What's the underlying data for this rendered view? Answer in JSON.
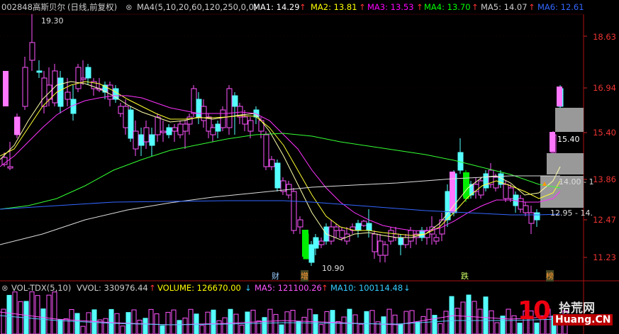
{
  "header": {
    "code": "002848",
    "name": "高斯贝尔",
    "mode": "(日线,前复权)",
    "indicator": "MA4(5,10,20,60,120,250,0,0)",
    "ma": [
      {
        "label": "MA1: 14.29",
        "color": "#ffffff",
        "arrow": "↑"
      },
      {
        "label": "MA2: 13.81",
        "color": "#ffff00",
        "arrow": "↑"
      },
      {
        "label": "MA3: 13.53",
        "color": "#ff00ff",
        "arrow": "↑"
      },
      {
        "label": "MA4: 13.70",
        "color": "#00ff00",
        "arrow": "↑"
      },
      {
        "label": "MA5: 14.07",
        "color": "#cccccc",
        "arrow": "↑"
      },
      {
        "label": "MA6: 12.61",
        "color": "#3366ff",
        "arrow": ""
      }
    ]
  },
  "price_axis": [
    "18.63",
    "16.94",
    "15.40",
    "13.86",
    "12.47",
    "11.23"
  ],
  "annotations": {
    "high": "19.30",
    "low": "10.90",
    "box_upper": "15.40",
    "box_mid": "14.00 - 1",
    "box_lower": "12.95 - 14."
  },
  "event_markers": [
    "财",
    "增",
    "跌",
    "榜"
  ],
  "volume_header": {
    "name": "VOL-TDX(5,10)",
    "vvol": "VVOL: 330976.44",
    "vvol_arrow": "↑",
    "volume": "VOLUME: 126670.00",
    "volume_arrow": "↓",
    "ma5": "MA5: 121100.26",
    "ma5_arrow": "↑",
    "ma10": "MA10: 100114.48",
    "ma10_arrow": "↓"
  },
  "watermark": {
    "number": "10",
    "cn": "拾荒网",
    "url": "Huang.CN"
  },
  "colors": {
    "up": "#ff55ff",
    "down": "#55ffff",
    "axis": "#cc2222",
    "bg": "#000000",
    "limit_up": "#00ff00"
  }
}
